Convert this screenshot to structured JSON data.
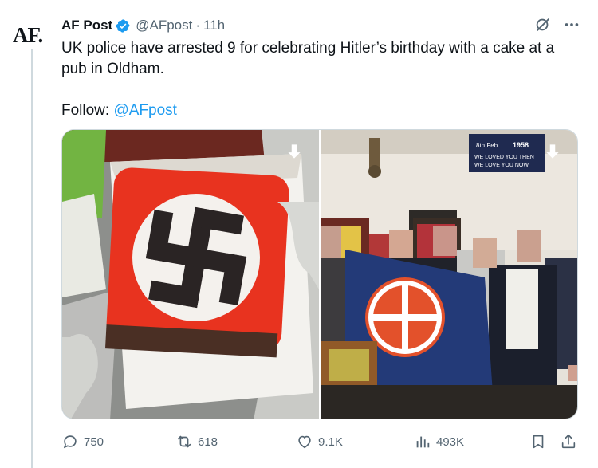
{
  "account": {
    "avatar_text": "AF.",
    "name": "AF Post",
    "handle": "@AFpost",
    "separator": "·",
    "time": "11h"
  },
  "tweet": {
    "body": "UK police have arrested 9 for celebrating Hitler’s birthday with a cake at a pub in Oldham.",
    "follow_label": "Follow: ",
    "follow_link": "@AFpost"
  },
  "media": [
    {
      "description": "cake-photo"
    },
    {
      "description": "group-with-flag-photo",
      "banner_lines": [
        "8th Feb",
        "1958",
        "WE LOVED YOU THEN",
        "WE LOVE YOU NOW"
      ]
    }
  ],
  "stats": {
    "replies": "750",
    "reposts": "618",
    "likes": "9.1K",
    "views": "493K"
  },
  "colors": {
    "link": "#1d9bf0",
    "verified": "#1d9bf0",
    "muted": "#536471"
  }
}
